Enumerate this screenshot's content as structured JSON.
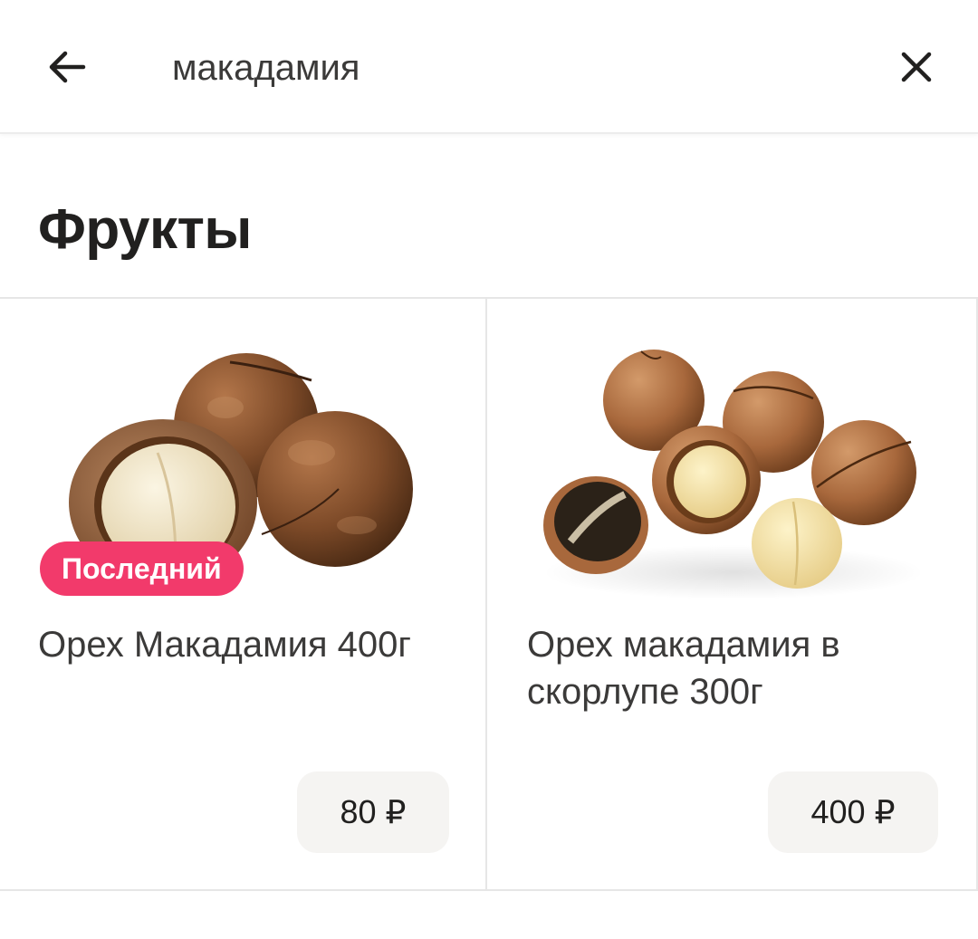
{
  "search": {
    "query": "макадамия",
    "back_icon": "arrow-left-icon",
    "clear_icon": "close-icon"
  },
  "section": {
    "title": "Фрукты"
  },
  "products": [
    {
      "name": "Орех Макадамия 400г",
      "badge": "Последний",
      "price": "80 ₽",
      "image": "macadamia-nuts-image"
    },
    {
      "name": "Орех макадамия в скорлупе 300г",
      "price": "400 ₽",
      "image": "macadamia-in-shell-image"
    }
  ],
  "colors": {
    "badge_bg": "#f23a6b",
    "price_bg": "#f5f4f2",
    "text_primary": "#21201f"
  }
}
